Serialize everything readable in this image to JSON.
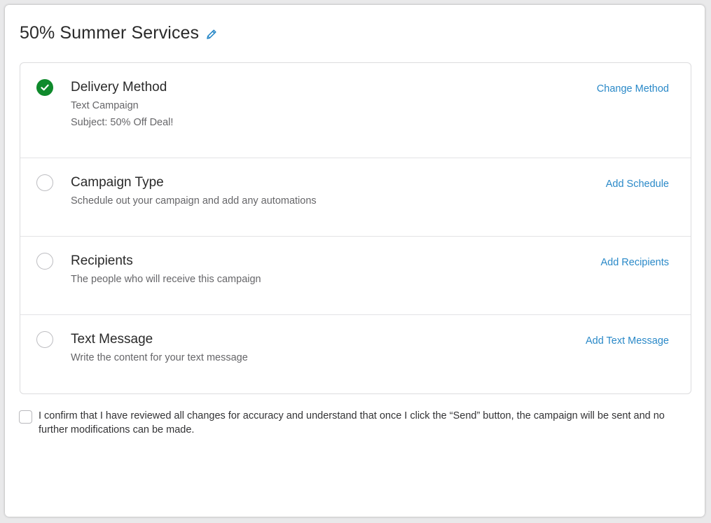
{
  "campaign": {
    "title": "50% Summer Services",
    "edit_icon": "pencil-icon"
  },
  "colors": {
    "accent": "#2a89c8",
    "complete": "#0f8a2c",
    "pending_border": "#bdbdc1"
  },
  "steps": [
    {
      "status": "complete",
      "status_icon": "check-circle-icon",
      "title": "Delivery Method",
      "lines": [
        "Text Campaign",
        "Subject: 50% Off Deal!"
      ],
      "action": "Change Method"
    },
    {
      "status": "pending",
      "status_icon": "empty-circle-icon",
      "title": "Campaign Type",
      "lines": [
        "Schedule out your campaign and add any automations"
      ],
      "action": "Add Schedule"
    },
    {
      "status": "pending",
      "status_icon": "empty-circle-icon",
      "title": "Recipients",
      "lines": [
        "The people who will receive this campaign"
      ],
      "action": "Add Recipients"
    },
    {
      "status": "pending",
      "status_icon": "empty-circle-icon",
      "title": "Text Message",
      "lines": [
        "Write the content for your text message"
      ],
      "action": "Add Text Message"
    }
  ],
  "confirm": {
    "checked": false,
    "text": "I confirm that I have reviewed all changes for accuracy and understand that once I click the “Send” button, the campaign will be sent and no further modifications can be made."
  }
}
